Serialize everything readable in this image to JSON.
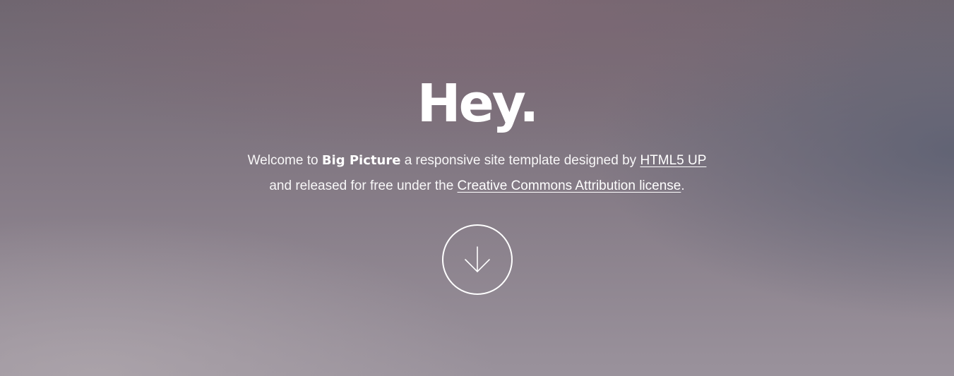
{
  "hero": {
    "title": "Hey.",
    "intro": {
      "prefix": "Welcome to",
      "brand": "Big Picture",
      "middle": "a responsive site template designed by",
      "author_link": "HTML5 UP",
      "line2_prefix": "and released for free under the",
      "license_link": "Creative Commons Attribution license",
      "suffix": "."
    },
    "scroll_button": {
      "icon": "arrow-down-icon"
    }
  },
  "colors": {
    "text": "#ffffff",
    "background_top": "#806874",
    "background_right": "#5c6072",
    "background_bottom_left": "#b0a8ae"
  }
}
